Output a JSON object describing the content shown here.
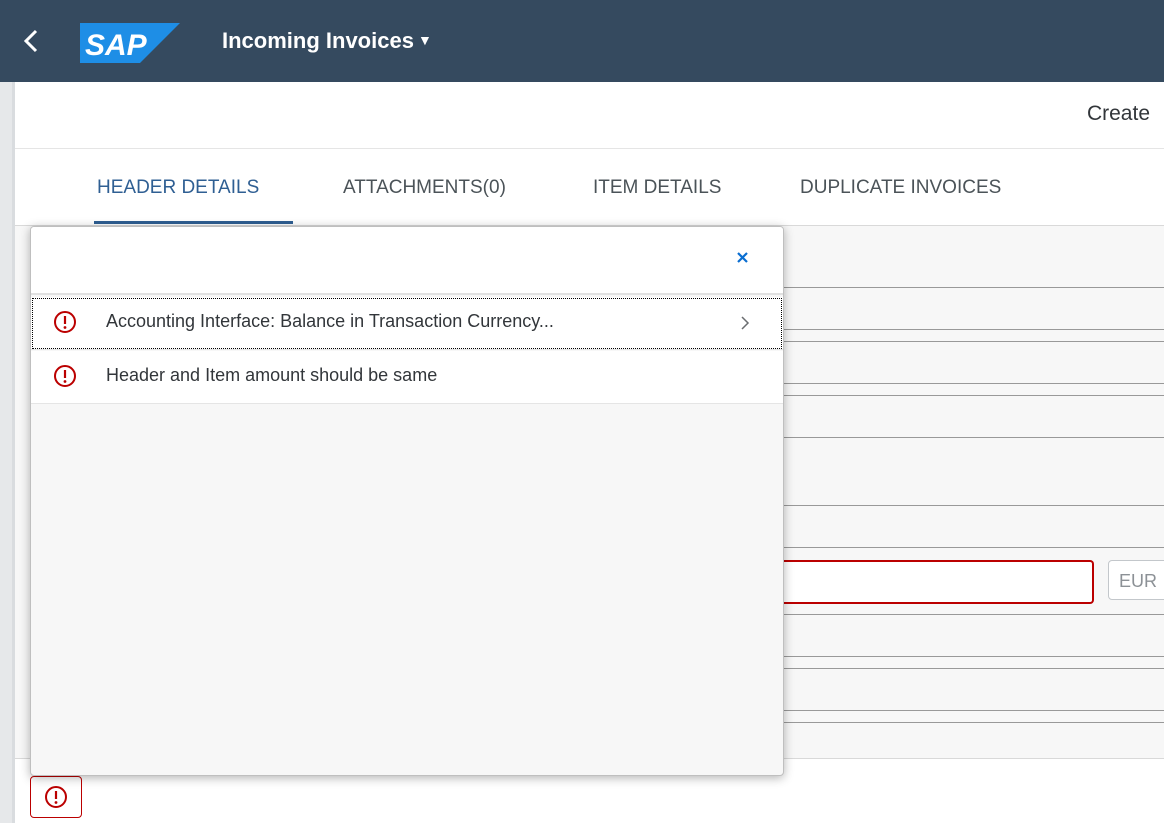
{
  "shell": {
    "back_icon": "chevron-left-icon",
    "logo_text": "SAP",
    "app_title": "Incoming Invoices",
    "title_caret": "▼",
    "colors": {
      "shell_bg": "#354a5f",
      "logo_blue": "#1e8ee6",
      "accent": "#2f5f93",
      "error": "#bb0000"
    }
  },
  "toolbar": {
    "create_label": "Create"
  },
  "tabs": [
    {
      "label": "HEADER DETAILS",
      "selected": true
    },
    {
      "label": "ATTACHMENTS(0)",
      "selected": false
    },
    {
      "label": "ITEM DETAILS",
      "selected": false
    },
    {
      "label": "DUPLICATE INVOICES",
      "selected": false
    }
  ],
  "form": {
    "currency_value": "EUR"
  },
  "message_popover": {
    "close_icon": "close-icon",
    "messages": [
      {
        "type": "error",
        "icon": "error-icon",
        "text": "Accounting Interface: Balance in Transaction Currency...",
        "has_details": true
      },
      {
        "type": "error",
        "icon": "error-icon",
        "text": "Header and Item amount should be same",
        "has_details": false
      }
    ]
  },
  "footer": {
    "message_button_icon": "error-icon"
  }
}
